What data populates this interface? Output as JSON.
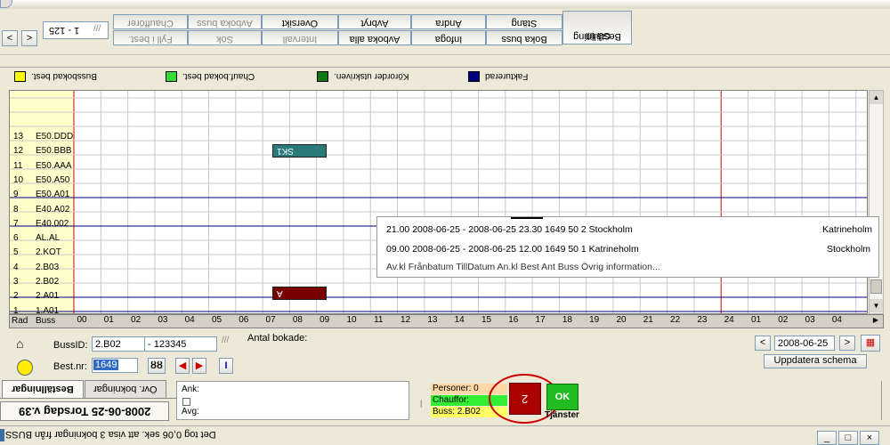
{
  "toolbar": {
    "nav_prev": "<",
    "nav_next": ">",
    "record_range": "1 - 125",
    "buttons_top": [
      "Chaufförer",
      "Avboka buss",
      "Översikt",
      "Avbryt",
      "Ändra",
      "Stäng",
      "Beställning"
    ],
    "buttons_bottom": [
      "Fyll i best.",
      "Sök",
      "Intervall",
      "Avboka alla",
      "Infoga",
      "Boka buss",
      "Gå till"
    ]
  },
  "legend": [
    {
      "label": "Bussbokad best.",
      "color": "#ffff00"
    },
    {
      "label": "Chauf.bokad best.",
      "color": "#33dd33"
    },
    {
      "label": "Körorder utskriven.",
      "color": "#117711"
    },
    {
      "label": "Fakturerad",
      "color": "#000080"
    }
  ],
  "schedule": {
    "header_row": "Rad",
    "header_bus": "Buss",
    "hours": [
      "00",
      "01",
      "02",
      "03",
      "04",
      "05",
      "06",
      "07",
      "08",
      "09",
      "10",
      "11",
      "12",
      "13",
      "14",
      "15",
      "16",
      "17",
      "18",
      "19",
      "20",
      "21",
      "22",
      "23",
      "24",
      "01",
      "02",
      "03",
      "04"
    ],
    "rows": [
      {
        "num": "13",
        "bus": "E50.DDD"
      },
      {
        "num": "12",
        "bus": "E50.BBB"
      },
      {
        "num": "11",
        "bus": "E50.AAA"
      },
      {
        "num": "10",
        "bus": "E50.A50"
      },
      {
        "num": "9",
        "bus": "E50.A01"
      },
      {
        "num": "8",
        "bus": "E40.A02"
      },
      {
        "num": "7",
        "bus": "E40.002"
      },
      {
        "num": "6",
        "bus": "AL.AL"
      },
      {
        "num": "5",
        "bus": "2.KOT"
      },
      {
        "num": "4",
        "bus": "2.B03"
      },
      {
        "num": "3",
        "bus": "2.B02"
      },
      {
        "num": "2",
        "bus": "2.A01"
      },
      {
        "num": "1",
        "bus": "1.A01"
      }
    ],
    "bookings": [
      {
        "label": "SK1",
        "color": "#2a7a7a"
      },
      {
        "label": "A",
        "color": "#7a0000"
      }
    ]
  },
  "info_panel": {
    "header": "Av.kl  Frånbatum  TillDatum  An.kl  Best  Ant  Buss  Övrig information...",
    "line1": "09.00  2008-06-25 - 2008-06-25  12.00  1649  50  1  Katrineholm",
    "line1_right": "Stockholm",
    "line2": "21.00  2008-06-25 - 2008-06-25  23.30  1649  50  2  Stockholm",
    "line2_right": "Katrineholm"
  },
  "form": {
    "bussid_label": "BussID:",
    "bussid_value": "2.B02",
    "bussid_extra": "- 123345",
    "bestnr_label": "Best.nr:",
    "bestnr_value": "1649",
    "antal_label": "Antal bokade:",
    "search_icon": "binoculars-icon",
    "date_value": "2008-06-25",
    "update_button": "Uppdatera schema"
  },
  "tabs": [
    "Beställningar",
    "Övr. bokningar"
  ],
  "notes": {
    "ank_label": "Ank:",
    "avg_label": "Avg:"
  },
  "summary": {
    "personer": "Personer: 0",
    "chauffor": "Chauffor:",
    "buss": "Buss: 2.B02",
    "count": "2",
    "ok": "OK",
    "tjanster": "Tjänster"
  },
  "status": {
    "date_line": "2008-06-25 Torsdag v.39",
    "message": "Det tog 0,06 sek. att visa 3 bokningar från BUSS"
  },
  "colors": {
    "accent_red": "#aa0000",
    "ok_green": "#22bb22",
    "personer_bg": "#ffd8a8",
    "chauffor_bg": "#33ee33",
    "buss_bg": "#ffff66"
  }
}
